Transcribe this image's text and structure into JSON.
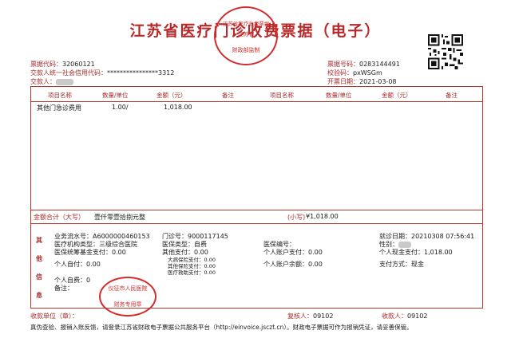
{
  "header": {
    "title": "江苏省医疗门诊收费票据（电子）",
    "left": {
      "code_label": "票据代码：",
      "code": "32060121",
      "credit_label": "交款人统一社会信用代码：",
      "credit": "****************3312",
      "payer_label": "交款人："
    },
    "right": {
      "no_label": "票据号码：",
      "no": "0283144491",
      "check_label": "校验码：",
      "check": "pxWSGm",
      "date_label": "开票日期：",
      "date": "2021-03-08"
    },
    "seal_top": {
      "line1": "江苏省医疗收费票据",
      "line2": "江苏省",
      "line3": "财政部监制"
    }
  },
  "table": {
    "columns": [
      "项目名称",
      "数量/单位",
      "金额（元）",
      "备注",
      "项目名称",
      "数量/单位",
      "金额（元）",
      "备注"
    ],
    "rows": [
      {
        "name": "其他门急诊费用",
        "qty": "1.00/",
        "amount": "1,018.00",
        "note": ""
      }
    ]
  },
  "total": {
    "label": "金额合计（大写）",
    "upper": "壹仟零壹拾捌元整",
    "lower_label": "(小写)",
    "lower": "¥1,018.00"
  },
  "other_info": {
    "side_label": [
      "其",
      "他",
      "信",
      "息"
    ],
    "serial_label": "业务流水号：",
    "serial": "A6000000460153",
    "org_type_label": "医疗机构类型：",
    "org_type": "三级综合医院",
    "fund_label": "医保统筹基金支付：",
    "fund": "0.00",
    "self_pay_label": "个人自付：",
    "self_pay": "0.00",
    "self_exp_label": "个人自费：",
    "self_exp": "0",
    "remark_label": "备注：",
    "clinic_no_label": "门诊号：",
    "clinic_no": "9000117145",
    "ins_type_label": "医保类型：",
    "ins_type": "自费",
    "other_pay_label": "其他支付：",
    "other_pay": "0.00",
    "big_label": "大病保险支付：",
    "big": "0.00",
    "ins_pay_label": "其他保险支付：",
    "ins_pay": "0.00",
    "rescue_label": "医疗救助支付：",
    "rescue": "0.00",
    "ins_no_label": "医保编号：",
    "acct_pay_label": "个人账户支付：",
    "acct_pay": "0.00",
    "acct_bal_label": "个人账户余额：",
    "acct_bal": "0.00",
    "visit_date_label": "就诊日期：",
    "visit_date": "20210308  07:56:41",
    "gender_label": "性别：",
    "cash_label": "个人现金支付：",
    "cash": "1,018.00",
    "method_label": "支付方式：",
    "method": "现金"
  },
  "footer": {
    "payee_unit_label": "收款单位（章）：",
    "reviewer_label": "复核人：",
    "reviewer": "09102",
    "payee_label": "收款人：",
    "payee": "09102",
    "note": "真伪查验、报销入账反馈，请登录江苏省财政电子票据公共服务平台（http://einvoice.jsczt.cn）。财政电子票据可作为报销凭证，请妥善保管。",
    "seal_bottom": {
      "line1": "仪征市人民医院",
      "line2": "财务专用章"
    }
  },
  "colors": {
    "accent": "#b8292a",
    "seal": "#d42a2a"
  }
}
